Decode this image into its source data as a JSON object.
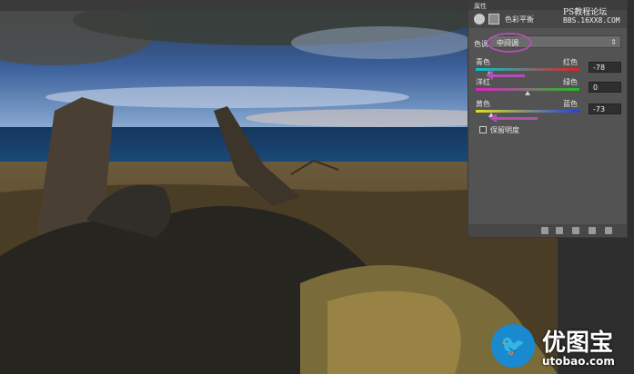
{
  "panel": {
    "tab": "属性",
    "title": "色彩平衡",
    "watermark_line1": "PS教程论坛",
    "watermark_line2": "BBS.16XX8.COM"
  },
  "tone": {
    "label": "色调:",
    "value": "中间调"
  },
  "sliders": [
    {
      "left_label": "青色",
      "right_label": "红色",
      "value": "-78"
    },
    {
      "left_label": "洋红",
      "right_label": "绿色",
      "value": "0"
    },
    {
      "left_label": "黄色",
      "right_label": "蓝色",
      "value": "-73"
    }
  ],
  "preserve_luminosity": {
    "label": "保留明度",
    "checked": false
  },
  "logo": {
    "name": "优图宝",
    "url": "utobao.com"
  },
  "colors": {
    "panel_bg": "#535353",
    "annotation": "#b24fb5",
    "logo_blue": "#1a8ad0"
  }
}
